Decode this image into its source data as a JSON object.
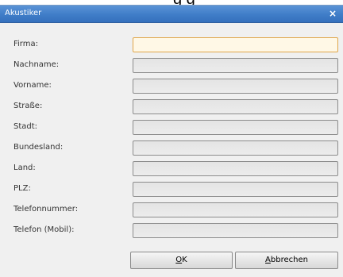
{
  "background": {
    "text_fragment": "g g"
  },
  "window": {
    "title": "Akustiker",
    "close_glyph": "×",
    "titlebar_color": "#3f7dc8"
  },
  "form": {
    "fields": [
      {
        "label": "Firma:",
        "value": "",
        "focused": true
      },
      {
        "label": "Nachname:",
        "value": ""
      },
      {
        "label": "Vorname:",
        "value": ""
      },
      {
        "label": "Straße:",
        "value": ""
      },
      {
        "label": "Stadt:",
        "value": ""
      },
      {
        "label": "Bundesland:",
        "value": ""
      },
      {
        "label": "Land:",
        "value": ""
      },
      {
        "label": "PLZ:",
        "value": ""
      },
      {
        "label": "Telefonnummer:",
        "value": ""
      },
      {
        "label": "Telefon (Mobil):",
        "value": ""
      }
    ]
  },
  "buttons": {
    "ok": {
      "mnemonic": "O",
      "rest": "K"
    },
    "cancel": {
      "mnemonic": "A",
      "rest": "bbrechen"
    }
  },
  "colors": {
    "focus_border": "#e0a64a",
    "dialog_bg": "#f0f0f0"
  }
}
